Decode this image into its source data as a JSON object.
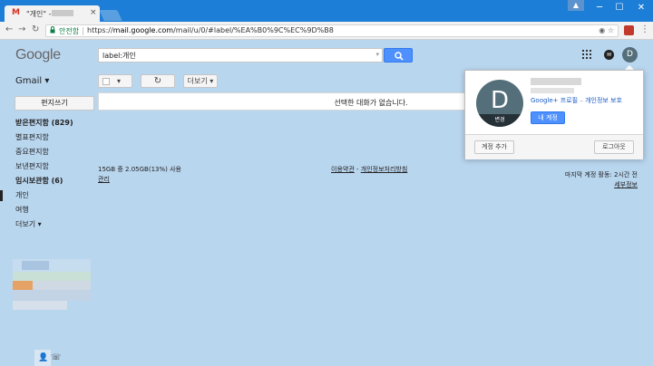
{
  "browser": {
    "tab_title": "\"개인\" -",
    "close_glyph": "×",
    "user_glyph": "▲",
    "minimize_glyph": "─",
    "maximize_glyph": "☐",
    "close_window_glyph": "✕",
    "back_glyph": "←",
    "forward_glyph": "→",
    "reload_glyph": "↻",
    "security_label": "안전함",
    "url_scheme": "https://",
    "url_host": "mail.google.com",
    "url_path": "/mail/u/0/#label/%EA%B0%9C%EC%9D%B8",
    "omnibox_icons": "◉ ☆",
    "menu_glyph": "⋮"
  },
  "header": {
    "logo": "Google",
    "search_value": "label:개인",
    "search_dropdown": "▾",
    "notif_label": "✉",
    "avatar_letter": "D",
    "accent_color": "#4d90fe"
  },
  "sidebar": {
    "app_label": "Gmail ▾",
    "compose_label": "편지쓰기",
    "items": [
      {
        "label": "받은편지함 (829)",
        "bold": true
      },
      {
        "label": "별표편지함"
      },
      {
        "label": "중요편지함"
      },
      {
        "label": "보낸편지함"
      },
      {
        "label": "임시보관함 (6)",
        "bold": true
      },
      {
        "label": "개인",
        "active": true
      },
      {
        "label": "여행"
      },
      {
        "label": "더보기 ▾"
      }
    ],
    "bottom_icons": "👤   ☏"
  },
  "toolbar": {
    "select_caret": "▾",
    "refresh_glyph": "↻",
    "more_label": "더보기 ▾"
  },
  "main": {
    "empty_message": "선택한 대화가 없습니다."
  },
  "footer": {
    "storage": "15GB 중 2.05GB(13%) 사용",
    "manage": "관리",
    "terms": "이용약관",
    "dash": " - ",
    "privacy": "개인정보처리방침",
    "last_activity": "마지막 계정 활동: 2시간 전",
    "details": "세부정보"
  },
  "account_popup": {
    "avatar_letter": "D",
    "change_label": "변경",
    "gplus_link": "Google+ 프로필",
    "dash": " – ",
    "privacy_link": "개인정보 보호",
    "my_account_label": "내 계정",
    "add_account_label": "계정 추가",
    "logout_label": "로그아웃"
  }
}
